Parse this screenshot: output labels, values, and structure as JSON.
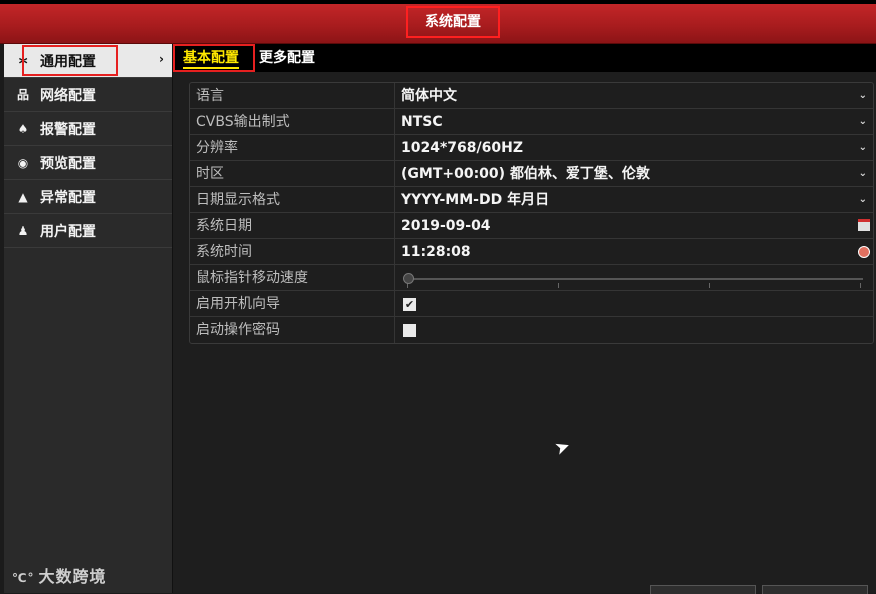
{
  "window": {
    "title": "系统配置"
  },
  "sidebar": {
    "items": [
      {
        "label": "通用配置",
        "icon": "general-config-icon",
        "glyph": "✲",
        "active": true
      },
      {
        "label": "网络配置",
        "icon": "network-icon",
        "glyph": "品"
      },
      {
        "label": "报警配置",
        "icon": "alarm-icon",
        "glyph": "♠"
      },
      {
        "label": "预览配置",
        "icon": "eye-icon",
        "glyph": "◉"
      },
      {
        "label": "异常配置",
        "icon": "warning-icon",
        "glyph": "▲"
      },
      {
        "label": "用户配置",
        "icon": "users-icon",
        "glyph": "♟"
      }
    ],
    "chevron": "›"
  },
  "watermark": {
    "logo": "℃°",
    "text": "大数跨境"
  },
  "tabs": [
    {
      "label": "基本配置",
      "active": true
    },
    {
      "label": "更多配置"
    }
  ],
  "form": {
    "language": {
      "label": "语言",
      "value": "简体中文"
    },
    "cvbs": {
      "label": "CVBS输出制式",
      "value": "NTSC"
    },
    "resolution": {
      "label": "分辨率",
      "value": "1024*768/60HZ"
    },
    "timezone": {
      "label": "时区",
      "value": "(GMT+00:00) 都伯林、爱丁堡、伦敦"
    },
    "date_format": {
      "label": "日期显示格式",
      "value": "YYYY-MM-DD 年月日"
    },
    "system_date": {
      "label": "系统日期",
      "value": "2019-09-04"
    },
    "system_time": {
      "label": "系统时间",
      "value": "11:28:08"
    },
    "mouse_speed": {
      "label": "鼠标指针移动速度",
      "level": 0
    },
    "startup_wizard": {
      "label": "启用开机向导",
      "checked": true
    },
    "operation_password": {
      "label": "启动操作密码",
      "checked": false
    }
  },
  "glyphs": {
    "caret": "⌄",
    "check": "✔"
  },
  "colors": {
    "title_bar": "#b22022",
    "highlight_box": "#e62020",
    "active_tab": "#ffe800"
  }
}
